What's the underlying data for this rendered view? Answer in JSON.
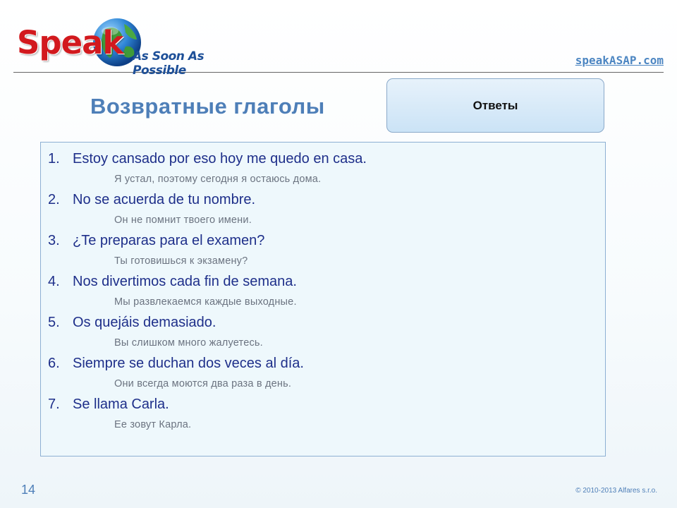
{
  "header": {
    "logo": {
      "speak": "Speak",
      "tagline": "As Soon As Possible"
    },
    "site_link": "speakASAP.com"
  },
  "page_title": "Возвратные глаголы",
  "answers_button_label": "Ответы",
  "items": [
    {
      "num": "1.",
      "spanish": "Estoy cansado por eso hoy me quedo en casa.",
      "translation": "Я устал, поэтому сегодня я остаюсь дома."
    },
    {
      "num": "2.",
      "spanish": "No se acuerda de tu nombre.",
      "translation": "Он не помнит твоего имени."
    },
    {
      "num": "3.",
      "spanish": "¿Te preparas para el examen?",
      "translation": "Ты готовишься к экзамену?"
    },
    {
      "num": "4.",
      "spanish": "Nos divertimos cada fin de semana.",
      "translation": "Мы развлекаемся каждые выходные."
    },
    {
      "num": "5.",
      "spanish": "Os quejáis demasiado.",
      "translation": "Вы слишком много жалуетесь."
    },
    {
      "num": "6.",
      "spanish": "Siempre se duchan dos veces al día.",
      "translation": "Они всегда моются два раза в день."
    },
    {
      "num": "7.",
      "spanish": "Se llama Carla.",
      "translation": "Ее зовут Карла."
    }
  ],
  "footer": {
    "slide_number": "14",
    "copyright": "© 2010-2013 Alfares s.r.o."
  },
  "colors": {
    "logo_red": "#d2191e",
    "logo_blue": "#1d4f98",
    "title_blue": "#4e7fb8",
    "spanish_text": "#1e2f8a",
    "translation_text": "#6b7380",
    "panel_bg": "#eef8fc",
    "panel_border": "#8db0d3",
    "button_bg": "#cbe3f6"
  }
}
